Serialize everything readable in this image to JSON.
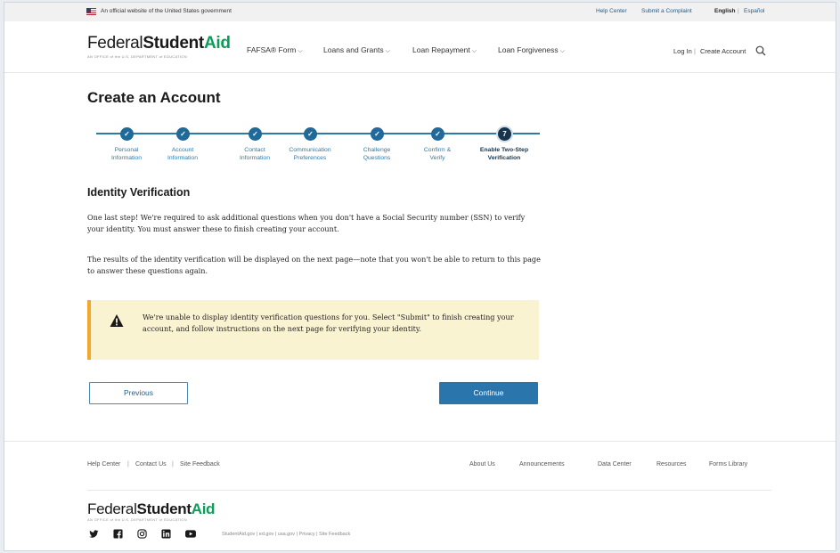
{
  "gov_banner": {
    "text": "An official website of the United States government",
    "help_center": "Help Center",
    "submit_complaint": "Submit a Complaint",
    "english": "English",
    "espanol": "Español",
    "separator": "|"
  },
  "header": {
    "logo_part1": "Federal",
    "logo_part2": "Student",
    "logo_part3": "Aid",
    "logo_sub": "AN OFFICE of the U.S. DEPARTMENT of EDUCATION",
    "nav": [
      {
        "label": "FAFSA® Form"
      },
      {
        "label": "Loans and Grants"
      },
      {
        "label": "Loan Repayment"
      },
      {
        "label": "Loan Forgiveness"
      }
    ],
    "chevron": "⌵",
    "login": "Log In",
    "separator": "|",
    "create_account": "Create Account",
    "search_icon": "search-icon"
  },
  "page": {
    "title": "Create an Account",
    "steps": [
      {
        "label_line1": "Personal",
        "label_line2": "Information",
        "status": "complete"
      },
      {
        "label_line1": "Account",
        "label_line2": "Information",
        "status": "complete"
      },
      {
        "label_line1": "Contact",
        "label_line2": "Information",
        "status": "complete"
      },
      {
        "label_line1": "Communication",
        "label_line2": "Preferences",
        "status": "complete"
      },
      {
        "label_line1": "Challenge",
        "label_line2": "Questions",
        "status": "complete"
      },
      {
        "label_line1": "Confirm &",
        "label_line2": "Verify",
        "status": "complete"
      },
      {
        "label_line1": "Enable Two-Step",
        "label_line2": "Verification",
        "status": "current",
        "number": "7"
      }
    ],
    "check_glyph": "✓",
    "section_title": "Identity Verification",
    "para1": "One last step! We're required to ask additional questions when you don't have a Social Security number (SSN) to verify your identity. You must answer these to finish creating your account.",
    "para2": "The results of the identity verification will be displayed on the next page—note that you won't be able to return to this page to answer these questions again.",
    "alert_icon": "warning-icon",
    "alert_text": "We're unable to display identity verification questions for you. Select \"Submit\" to finish creating your account, and follow instructions on the next page for verifying your identity.",
    "previous_label": "Previous",
    "continue_label": "Continue"
  },
  "footer": {
    "left_links": [
      "Help Center",
      "Contact Us",
      "Site Feedback"
    ],
    "separator": "|",
    "right_links": [
      "About Us",
      "Announcements",
      "Data Center",
      "Resources",
      "Forms Library"
    ],
    "logo_part1": "Federal",
    "logo_part2": "Student",
    "logo_part3": "Aid",
    "logo_sub": "AN OFFICE of the U.S. DEPARTMENT of EDUCATION",
    "social_icons": [
      "twitter-icon",
      "facebook-icon",
      "instagram-icon",
      "linkedin-icon",
      "youtube-icon"
    ],
    "bottom_links": "StudentAid.gov | ed.gov | usa.gov | Privacy | Site Feedback",
    "accent_color": "#0f9b59"
  }
}
